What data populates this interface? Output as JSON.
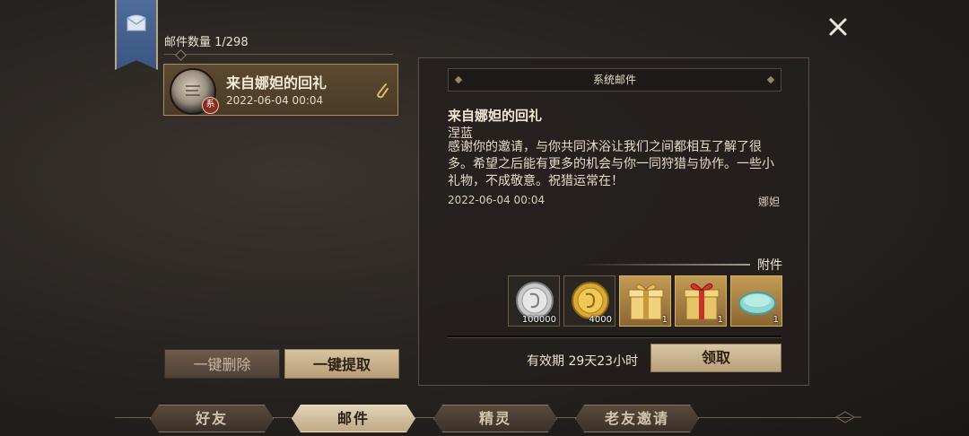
{
  "mail_count": "邮件数量 1/298",
  "mail_list": [
    {
      "title": "来自娜妲的回礼",
      "date": "2022-06-04 00:04",
      "badge": "系"
    }
  ],
  "buttons": {
    "delete_all": "一键删除",
    "collect_all": "一键提取",
    "claim": "领取"
  },
  "detail": {
    "header": "系统邮件",
    "title": "来自娜妲的回礼",
    "sender": "涅蓝",
    "body": "感谢你的邀请，与你共同沐浴让我们之间都相互了解了很多。希望之后能有更多的机会与你一同狩猎与协作。一些小礼物，不成敬意。祝猎运常在！",
    "date": "2022-06-04 00:04",
    "signature": "娜妲",
    "attachments_label": "附件",
    "attachments": [
      {
        "name": "silver-coin-icon",
        "count": "100000"
      },
      {
        "name": "gold-coin-icon",
        "count": "4000"
      },
      {
        "name": "gold-gift-box-icon",
        "count": "1"
      },
      {
        "name": "red-ribbon-gift-box-icon",
        "count": "1"
      },
      {
        "name": "soap-icon",
        "count": "1"
      }
    ],
    "expiry": "有效期 29天23小时"
  },
  "tabs": [
    "好友",
    "邮件",
    "精灵",
    "老友邀请"
  ],
  "active_tab": "邮件",
  "colors": {
    "banner": "#4a6592",
    "accent_gold": "#c39b55",
    "active_tab": "#d4c4a4"
  }
}
